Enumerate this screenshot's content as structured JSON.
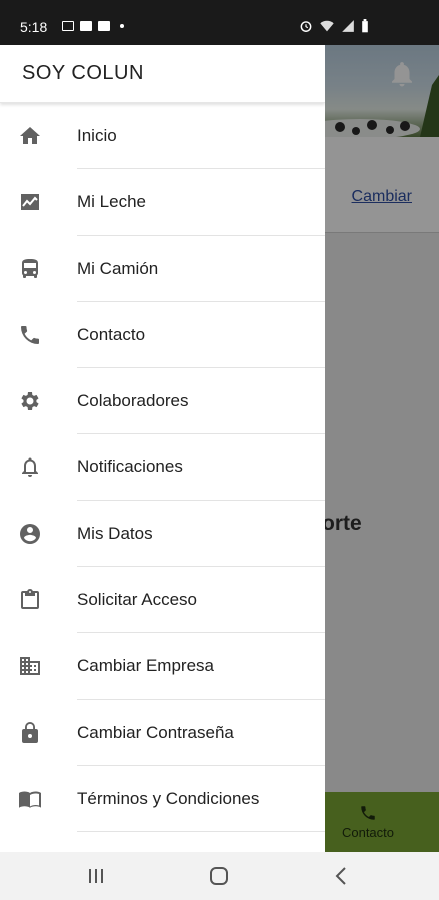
{
  "status_bar": {
    "time": "5:18"
  },
  "background": {
    "change_link": "Cambiar",
    "partial_text": "orte",
    "footer_item_label": "Contacto"
  },
  "drawer": {
    "title": "SOY COLUN",
    "items": [
      {
        "label": "Inicio",
        "icon": "home-icon"
      },
      {
        "label": "Mi Leche",
        "icon": "chart-icon"
      },
      {
        "label": "Mi Camión",
        "icon": "bus-icon"
      },
      {
        "label": "Contacto",
        "icon": "phone-icon"
      },
      {
        "label": "Colaboradores",
        "icon": "gear-icon"
      },
      {
        "label": "Notificaciones",
        "icon": "bell-icon"
      },
      {
        "label": "Mis Datos",
        "icon": "account-circle-icon"
      },
      {
        "label": "Solicitar Acceso",
        "icon": "clipboard-icon"
      },
      {
        "label": "Cambiar Empresa",
        "icon": "building-icon"
      },
      {
        "label": "Cambiar Contraseña",
        "icon": "lock-icon"
      },
      {
        "label": "Términos y Condiciones",
        "icon": "document-icon"
      }
    ]
  },
  "colors": {
    "drawer_bg": "#ffffff",
    "icon_gray": "#616161",
    "footer_green": "#7aa535",
    "link_blue": "#2f4fa2"
  }
}
